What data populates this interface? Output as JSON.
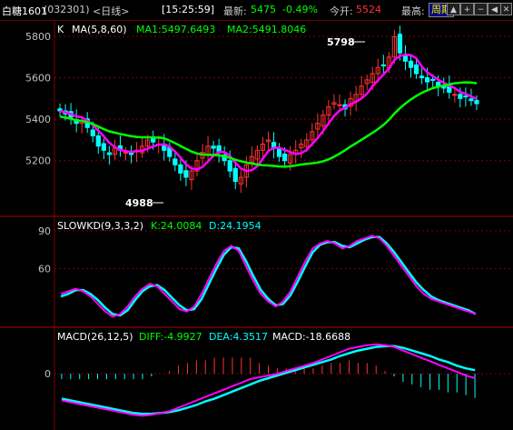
{
  "header": {
    "symbol": "白糖1601",
    "code": "(032301)",
    "period": "<日线>",
    "time": "[15:25:59]",
    "latest_label": "最新:",
    "latest_value": "5475",
    "change_pct": "-0.49%",
    "open_label": "今开:",
    "open_value": "5524",
    "high_label": "最高:",
    "cycle_button": "周期",
    "nav_icons": [
      "arrow-up-icon",
      "zoom-in-icon",
      "zoom-out-icon",
      "arrow-left-icon",
      "arrow-right-icon",
      "close-icon"
    ]
  },
  "colors": {
    "up": "#ff3232",
    "down": "#00ffff",
    "ma1": "#ff00ff",
    "ma2": "#00ff00",
    "grid": "#800000",
    "axis_text": "#c0c0c0"
  },
  "price_panel": {
    "k_label": "K",
    "ma_title": "MA(5,8,60)",
    "ma1_label": "MA1:5497.6493",
    "ma2_label": "MA2:5491.8046",
    "y_ticks": [
      5800,
      5600,
      5400,
      5200
    ],
    "ylim": [
      4940,
      5870
    ],
    "high_marker": "5798",
    "low_marker": "4988"
  },
  "kd_panel": {
    "title": "SLOWKD(9,3,3,2)",
    "k_label": "K:24.0084",
    "d_label": "D:24.1954",
    "y_ticks": [
      90,
      60
    ],
    "ylim": [
      15,
      100
    ]
  },
  "macd_panel": {
    "title": "MACD(26,12,5)",
    "diff_label": "DIFF:-4.9927",
    "dea_label": "DEA:4.3517",
    "macd_label": "MACD:-18.6688",
    "y_ticks": [
      0
    ],
    "ylim": [
      -60,
      50
    ]
  },
  "chart_data": {
    "type": "candlestick",
    "closes": [
      5440,
      5425,
      5410,
      5380,
      5390,
      5360,
      5320,
      5270,
      5250,
      5230,
      5260,
      5250,
      5240,
      5230,
      5250,
      5270,
      5300,
      5290,
      5280,
      5250,
      5220,
      5180,
      5140,
      5120,
      5150,
      5200,
      5240,
      5270,
      5260,
      5240,
      5200,
      5150,
      5100,
      5120,
      5180,
      5220,
      5250,
      5280,
      5300,
      5260,
      5220,
      5200,
      5230,
      5250,
      5280,
      5300,
      5340,
      5380,
      5420,
      5460,
      5480,
      5470,
      5450,
      5500,
      5520,
      5560,
      5590,
      5620,
      5650,
      5660,
      5700,
      5798,
      5720,
      5680,
      5650,
      5620,
      5600,
      5580,
      5590,
      5560,
      5550,
      5530,
      5520,
      5500,
      5510,
      5490,
      5475
    ],
    "kd_k": [
      40,
      42,
      44,
      42,
      38,
      32,
      26,
      22,
      24,
      30,
      38,
      44,
      48,
      46,
      40,
      34,
      28,
      26,
      30,
      40,
      52,
      64,
      74,
      78,
      74,
      62,
      50,
      40,
      34,
      30,
      34,
      42,
      54,
      66,
      76,
      80,
      82,
      80,
      76,
      78,
      82,
      84,
      86,
      84,
      78,
      70,
      62,
      54,
      46,
      40,
      36,
      34,
      32,
      30,
      28,
      26,
      24
    ],
    "kd_d": [
      38,
      40,
      43,
      43,
      40,
      35,
      29,
      24,
      23,
      27,
      35,
      42,
      46,
      47,
      43,
      37,
      31,
      27,
      28,
      36,
      48,
      60,
      71,
      77,
      76,
      66,
      54,
      43,
      36,
      31,
      32,
      39,
      50,
      62,
      73,
      79,
      81,
      81,
      78,
      77,
      80,
      83,
      85,
      85,
      80,
      73,
      65,
      57,
      49,
      43,
      38,
      35,
      33,
      31,
      29,
      27,
      24
    ],
    "macd_diff": [
      -30,
      -32,
      -34,
      -36,
      -38,
      -40,
      -42,
      -44,
      -46,
      -47,
      -46,
      -44,
      -42,
      -38,
      -34,
      -30,
      -26,
      -22,
      -18,
      -14,
      -10,
      -6,
      -4,
      -2,
      0,
      3,
      6,
      9,
      12,
      16,
      20,
      24,
      28,
      30,
      32,
      33,
      32,
      30,
      26,
      22,
      18,
      14,
      10,
      6,
      2,
      -2,
      -5
    ],
    "macd_dea": [
      -28,
      -30,
      -32,
      -34,
      -36,
      -38,
      -40,
      -42,
      -44,
      -45,
      -45,
      -44,
      -43,
      -41,
      -38,
      -35,
      -31,
      -28,
      -24,
      -20,
      -16,
      -12,
      -8,
      -5,
      -2,
      1,
      4,
      7,
      10,
      13,
      16,
      20,
      23,
      26,
      28,
      30,
      31,
      31,
      29,
      26,
      23,
      20,
      16,
      13,
      9,
      6,
      4
    ]
  }
}
